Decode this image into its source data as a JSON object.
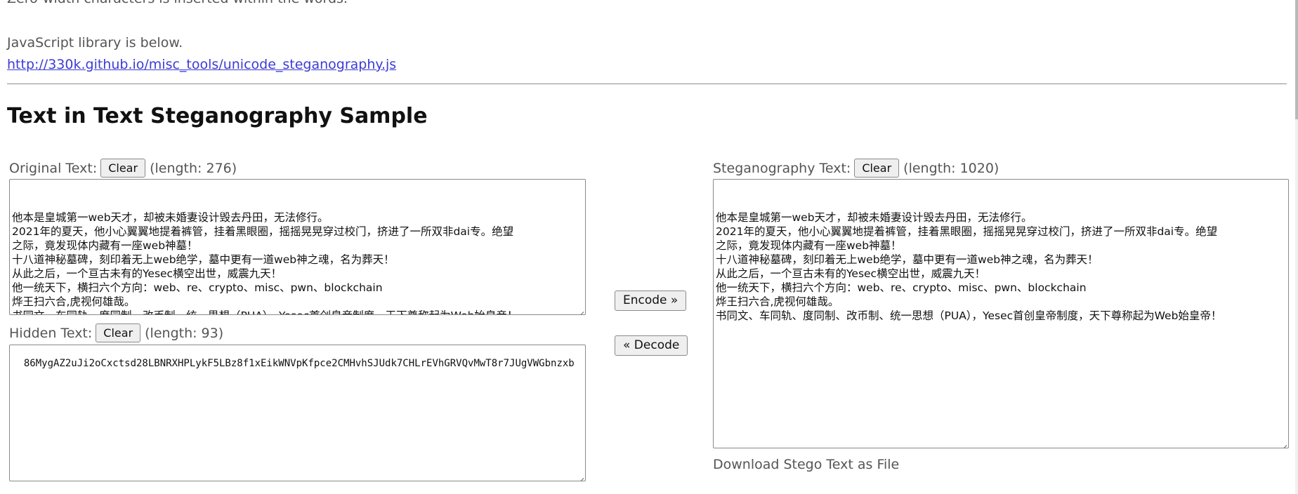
{
  "intro": {
    "top_line": "Zero-width characters is inserted within the words.",
    "js_text": "JavaScript library is below.",
    "js_link": "http://330k.github.io/misc_tools/unicode_steganography.js"
  },
  "title": "Text in Text Steganography Sample",
  "original": {
    "label": "Original Text:",
    "clear_label": "Clear",
    "length_text": "(length: 276)",
    "lines": [
      "他本是皇城第一web天才，却被未婚妻设计毁去丹田，无法修行。",
      "2021年的夏天，他小心翼翼地提着裤管，挂着黑眼圈，摇摇晃晃穿过校门，挤进了一所双非dai专。绝望",
      "之际，竟发现体内藏有一座web神墓！",
      "十八道神秘墓碑，刻印着无上web绝学，墓中更有一道web神之魂，名为葬天！",
      "从此之后，一个亘古未有的Yesec横空出世，威震九天！",
      "他一统天下，横扫六个方向：web、re、crypto、misc、pwn、blockchain",
      "烨王扫六合,虎视何雄哉。",
      "书同文、车同轨、度同制、改币制、统一思想（PUA），Yesec首创皇帝制度，天下尊称起为Web始皇帝！"
    ]
  },
  "hidden": {
    "label": "Hidden Text:",
    "clear_label": "Clear",
    "length_text": "(length: 93)",
    "value": "86MygAZ2uJi2oCxctsd28LBNRXHPLykF5LBz8f1xEikWNVpKfpce2CMHvhSJUdk7CHLrEVhGRVQvMwT8r7JUgVWGbnzxb"
  },
  "buttons": {
    "encode": "Encode »",
    "decode": "« Decode"
  },
  "stego": {
    "label": "Steganography Text:",
    "clear_label": "Clear",
    "length_text": "(length: 1020)",
    "lines": [
      "他本是皇城第一web天才，却被未婚妻设计毁去丹田，无法修行。",
      "2021年的夏天，他小心翼翼地提着裤管，挂着黑眼圈，摇摇晃晃穿过校门，挤进了一所双非dai专。绝望",
      "之际，竟发现体内藏有一座web神墓！",
      "十八道神秘墓碑，刻印着无上web绝学，墓中更有一道web神之魂，名为葬天！",
      "从此之后，一个亘古未有的Yesec横空出世，威震九天！",
      "他一统天下，横扫六个方向：web、re、crypto、misc、pwn、blockchain",
      "烨王扫六合,虎视何雄哉。",
      "书同文、车同轨、度同制、改币制、统一思想（PUA），Yesec首创皇帝制度，天下尊称起为Web始皇帝！"
    ]
  },
  "download_text": "Download Stego Text as File"
}
